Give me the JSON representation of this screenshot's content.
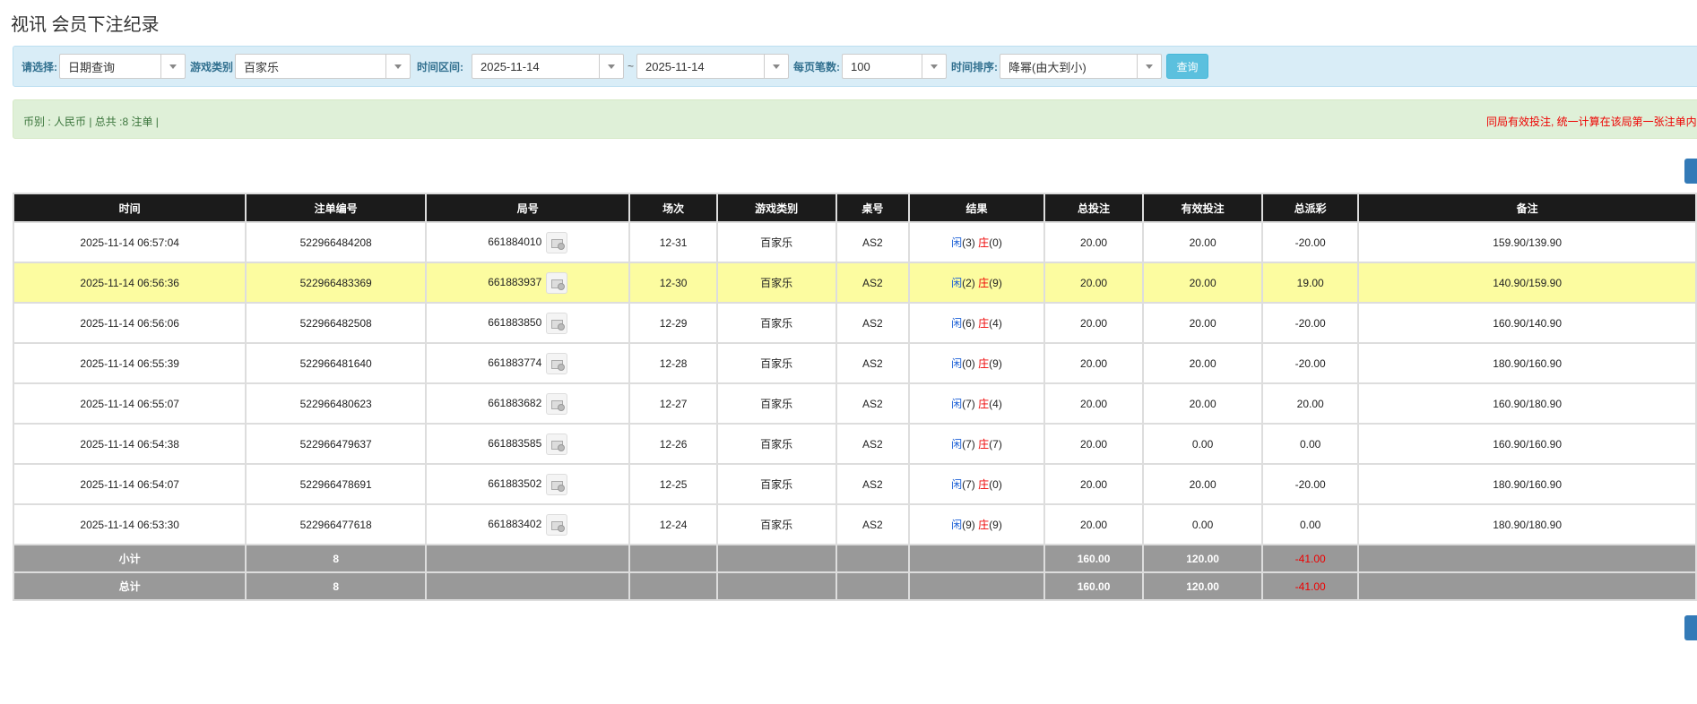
{
  "page_title": "视讯 会员下注纪录",
  "filters": {
    "select_label": "请选择:",
    "select_value": "日期查询",
    "game_type_label": "游戏类别",
    "game_type_value": "百家乐",
    "time_range_label": "时间区间:",
    "start_date": "2025-11-14",
    "range_separator": "~",
    "end_date": "2025-11-14",
    "page_size_label": "每页笔数:",
    "page_size_value": "100",
    "sort_label": "时间排序:",
    "sort_value": "降幂(由大到小)",
    "query_button": "查询"
  },
  "info_bar": {
    "summary": "币别 : 人民币 | 总共 :8 注单 |",
    "notice": "同局有效投注, 统一计算在该局第一张注单内"
  },
  "table": {
    "headers": [
      "时间",
      "注单编号",
      "局号",
      "场次",
      "游戏类别",
      "桌号",
      "结果",
      "总投注",
      "有效投注",
      "总派彩",
      "备注"
    ],
    "result_player_label": "闲",
    "result_banker_label": "庄",
    "rows": [
      {
        "time": "2025-11-14 06:57:04",
        "bet_id": "522966484208",
        "round_id": "661884010",
        "session": "12-31",
        "game": "百家乐",
        "table": "AS2",
        "player": "(3)",
        "banker": "(0)",
        "total_bet": "20.00",
        "valid_bet": "20.00",
        "payout": "-20.00",
        "payout_negative": true,
        "remark": "159.90/139.90",
        "highlight": false
      },
      {
        "time": "2025-11-14 06:56:36",
        "bet_id": "522966483369",
        "round_id": "661883937",
        "session": "12-30",
        "game": "百家乐",
        "table": "AS2",
        "player": "(2)",
        "banker": "(9)",
        "total_bet": "20.00",
        "valid_bet": "20.00",
        "payout": "19.00",
        "payout_negative": false,
        "remark": "140.90/159.90",
        "highlight": true
      },
      {
        "time": "2025-11-14 06:56:06",
        "bet_id": "522966482508",
        "round_id": "661883850",
        "session": "12-29",
        "game": "百家乐",
        "table": "AS2",
        "player": "(6)",
        "banker": "(4)",
        "total_bet": "20.00",
        "valid_bet": "20.00",
        "payout": "-20.00",
        "payout_negative": true,
        "remark": "160.90/140.90",
        "highlight": false
      },
      {
        "time": "2025-11-14 06:55:39",
        "bet_id": "522966481640",
        "round_id": "661883774",
        "session": "12-28",
        "game": "百家乐",
        "table": "AS2",
        "player": "(0)",
        "banker": "(9)",
        "total_bet": "20.00",
        "valid_bet": "20.00",
        "payout": "-20.00",
        "payout_negative": true,
        "remark": "180.90/160.90",
        "highlight": false
      },
      {
        "time": "2025-11-14 06:55:07",
        "bet_id": "522966480623",
        "round_id": "661883682",
        "session": "12-27",
        "game": "百家乐",
        "table": "AS2",
        "player": "(7)",
        "banker": "(4)",
        "total_bet": "20.00",
        "valid_bet": "20.00",
        "payout": "20.00",
        "payout_negative": false,
        "remark": "160.90/180.90",
        "highlight": false
      },
      {
        "time": "2025-11-14 06:54:38",
        "bet_id": "522966479637",
        "round_id": "661883585",
        "session": "12-26",
        "game": "百家乐",
        "table": "AS2",
        "player": "(7)",
        "banker": "(7)",
        "total_bet": "20.00",
        "valid_bet": "0.00",
        "payout": "0.00",
        "payout_negative": false,
        "remark": "160.90/160.90",
        "highlight": false
      },
      {
        "time": "2025-11-14 06:54:07",
        "bet_id": "522966478691",
        "round_id": "661883502",
        "session": "12-25",
        "game": "百家乐",
        "table": "AS2",
        "player": "(7)",
        "banker": "(0)",
        "total_bet": "20.00",
        "valid_bet": "20.00",
        "payout": "-20.00",
        "payout_negative": true,
        "remark": "180.90/160.90",
        "highlight": false
      },
      {
        "time": "2025-11-14 06:53:30",
        "bet_id": "522966477618",
        "round_id": "661883402",
        "session": "12-24",
        "game": "百家乐",
        "table": "AS2",
        "player": "(9)",
        "banker": "(9)",
        "total_bet": "20.00",
        "valid_bet": "0.00",
        "payout": "0.00",
        "payout_negative": false,
        "remark": "180.90/180.90",
        "highlight": false
      }
    ],
    "subtotal": {
      "label": "小计",
      "count": "8",
      "total_bet": "160.00",
      "valid_bet": "120.00",
      "payout": "-41.00"
    },
    "total": {
      "label": "总计",
      "count": "8",
      "total_bet": "160.00",
      "valid_bet": "120.00",
      "payout": "-41.00"
    }
  },
  "colors": {
    "header_bg": "#1b1b1b",
    "highlight_row": "#fcfca0",
    "footer_bg": "#999999",
    "player": "#1a5fd6",
    "banker": "#e00000",
    "filter_bg": "#d9edf7",
    "info_bg": "#dff0d8"
  },
  "icons": {
    "replay": "video-replay-icon",
    "dropdown": "chevron-down-icon"
  }
}
